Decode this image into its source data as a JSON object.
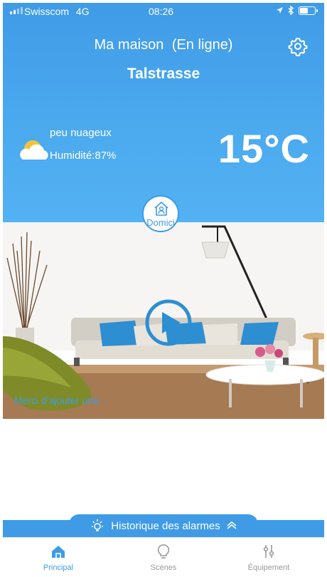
{
  "status_bar": {
    "carrier": "Swisscom",
    "network": "4G",
    "time": "08:26",
    "battery_level": 0.6
  },
  "header": {
    "home_name": "Ma maison",
    "connection_status": "(En ligne)",
    "street": "Talstrasse"
  },
  "weather": {
    "icon": "partly-cloudy-icon",
    "description": "peu nuageux",
    "humidity": "Humidité:87%",
    "temperature": "15°C"
  },
  "room": {
    "mode_label": "Domici",
    "add_message": "Merci d'ajouter une..."
  },
  "alarm_history": {
    "label": "Historique des alarmes"
  },
  "tabs": [
    {
      "label": "Principal",
      "icon": "home-icon",
      "active": true
    },
    {
      "label": "Scènes",
      "icon": "bulb-icon",
      "active": false
    },
    {
      "label": "Équipement",
      "icon": "equalizer-icon",
      "active": false
    }
  ],
  "colors": {
    "accent": "#3f9be6",
    "inactive_tab": "#9a9a9a"
  }
}
